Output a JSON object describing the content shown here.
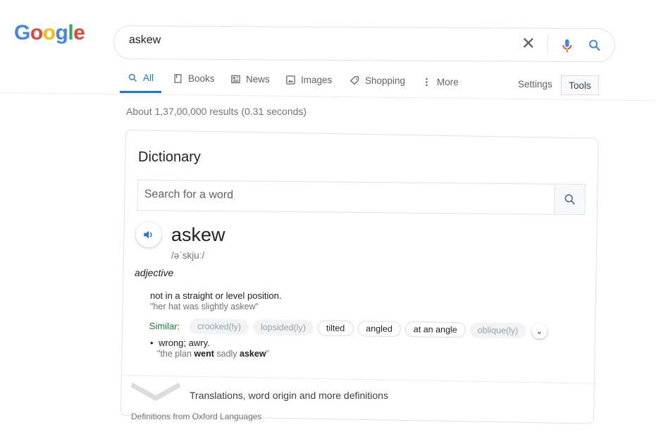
{
  "logo": {
    "letters": [
      {
        "char": "G",
        "color": "#4285F4"
      },
      {
        "char": "o",
        "color": "#EA4335"
      },
      {
        "char": "o",
        "color": "#FBBC05"
      },
      {
        "char": "g",
        "color": "#4285F4"
      },
      {
        "char": "l",
        "color": "#34A853"
      },
      {
        "char": "e",
        "color": "#EA4335"
      }
    ]
  },
  "search": {
    "value": "askew",
    "clear_icon": "close-icon",
    "mic_icon": "microphone-icon",
    "search_icon": "search-icon"
  },
  "tabs": [
    {
      "label": "All",
      "icon": "search-icon",
      "active": true
    },
    {
      "label": "Books",
      "icon": "book-icon"
    },
    {
      "label": "News",
      "icon": "newspaper-icon"
    },
    {
      "label": "Images",
      "icon": "image-icon"
    },
    {
      "label": "Shopping",
      "icon": "tag-icon"
    },
    {
      "label": "More",
      "icon": "more-vert-icon"
    }
  ],
  "settings_label": "Settings",
  "tools_label": "Tools",
  "results_count": "About 1,37,00,000 results (0.31 seconds)",
  "dictionary": {
    "title": "Dictionary",
    "search_placeholder": "Search for a word",
    "word": "askew",
    "phonetic": "/əˈskjuː/",
    "part_of_speech": "adjective",
    "definition_1": "not in a straight or level position.",
    "example_1": "\"her hat was slightly askew\"",
    "similar_label": "Similar:",
    "similar": [
      {
        "label": "crooked(ly)",
        "active": false
      },
      {
        "label": "lopsided(ly)",
        "active": false
      },
      {
        "label": "tilted",
        "active": true
      },
      {
        "label": "angled",
        "active": true
      },
      {
        "label": "at an angle",
        "active": true
      },
      {
        "label": "oblique(ly)",
        "active": false
      }
    ],
    "bullet": "•",
    "definition_2": "wrong; awry.",
    "example_2": {
      "open_quote": "\"",
      "pre": "the plan ",
      "bold1": "went",
      "mid": " sadly ",
      "bold2": "askew",
      "close_quote": "\""
    },
    "more_link": "Translations, word origin and more definitions",
    "source": "Definitions from Oxford Languages"
  },
  "colors": {
    "accent": "#1a73e8",
    "similar_green": "#188038"
  }
}
